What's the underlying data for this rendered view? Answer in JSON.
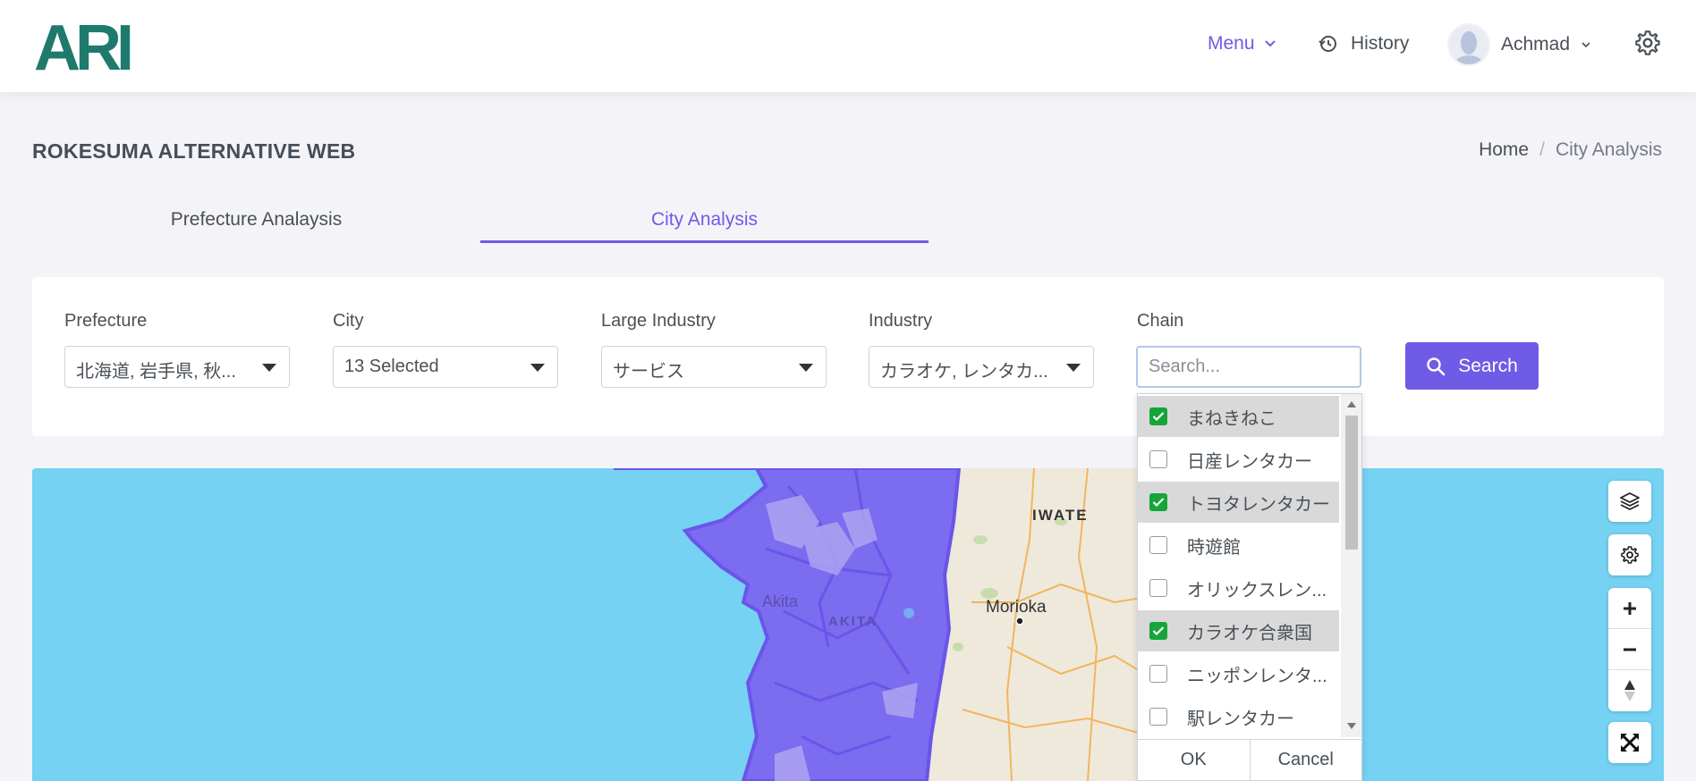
{
  "header": {
    "logo_text": "ARI",
    "menu_label": "Menu",
    "history_label": "History",
    "user_name": "Achmad"
  },
  "page": {
    "title": "ROKESUMA ALTERNATIVE WEB",
    "breadcrumb_home": "Home",
    "breadcrumb_sep": "/",
    "breadcrumb_current": "City Analysis"
  },
  "tabs": [
    {
      "label": "Prefecture Analaysis",
      "active": false
    },
    {
      "label": "City Analysis",
      "active": true
    }
  ],
  "filters": {
    "prefecture": {
      "label": "Prefecture",
      "value": "北海道, 岩手県, 秋..."
    },
    "city": {
      "label": "City",
      "value": "13 Selected"
    },
    "large_industry": {
      "label": "Large Industry",
      "value": "サービス"
    },
    "industry": {
      "label": "Industry",
      "value": "カラオケ, レンタカ..."
    },
    "chain": {
      "label": "Chain",
      "placeholder": "Search..."
    },
    "search_button": "Search"
  },
  "chain_options": [
    {
      "label": "まねきねこ",
      "checked": true
    },
    {
      "label": "日産レンタカー",
      "checked": false
    },
    {
      "label": "トヨタレンタカー",
      "checked": true
    },
    {
      "label": "時遊館",
      "checked": false
    },
    {
      "label": "オリックスレン...",
      "checked": false
    },
    {
      "label": "カラオケ合衆国",
      "checked": true
    },
    {
      "label": "ニッポンレンタ...",
      "checked": false
    },
    {
      "label": "駅レンタカー",
      "checked": false
    }
  ],
  "dropdown_actions": {
    "ok": "OK",
    "cancel": "Cancel"
  },
  "map": {
    "labels": {
      "iwate": "IWATE",
      "akita_city": "Akita",
      "akita_pref": "AKITA",
      "morioka": "Morioka"
    },
    "colors": {
      "sea": "#76d2f2",
      "region_fill": "#7b6cf0",
      "region_border": "#6a55ea",
      "land": "#efe9dc"
    }
  },
  "colors": {
    "accent": "#6f5be6",
    "check": "#17a53a",
    "logo": "#1f7a6e"
  }
}
